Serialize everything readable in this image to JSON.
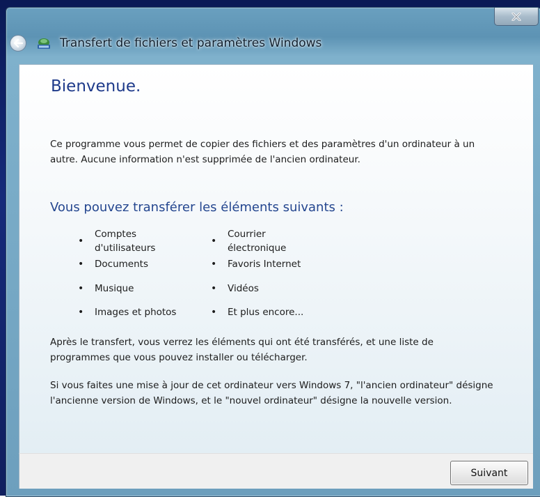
{
  "window": {
    "title": "Transfert de fichiers et paramètres Windows",
    "close_label": "X"
  },
  "content": {
    "heading": "Bienvenue.",
    "intro": "Ce programme vous permet de copier des fichiers et des paramètres d'un ordinateur à un autre. Aucune information n'est supprimée de l'ancien ordinateur.",
    "subheading": "Vous pouvez transférer les éléments suivants :",
    "items_left": [
      "Comptes d'utilisateurs",
      "Documents",
      "Musique",
      "Images et photos"
    ],
    "items_right": [
      "Courrier électronique",
      "Favoris Internet",
      "Vidéos",
      "Et plus encore..."
    ],
    "after_transfer": "Après le transfert, vous verrez les éléments qui ont été transférés, et une liste de programmes que vous pouvez installer ou télécharger.",
    "upgrade_note": "Si vous faites une mise à jour de cet ordinateur vers Windows 7, \"l'ancien ordinateur\" désigne l'ancienne version de Windows, et le \"nouvel ordinateur\" désigne la nouvelle version."
  },
  "footer": {
    "next_label": "Suivant"
  },
  "icons": {
    "back": "back-arrow-icon",
    "app": "transfer-wizard-icon",
    "close": "close-icon"
  },
  "colors": {
    "heading": "#1e3a8a",
    "subheading": "#24468f"
  }
}
